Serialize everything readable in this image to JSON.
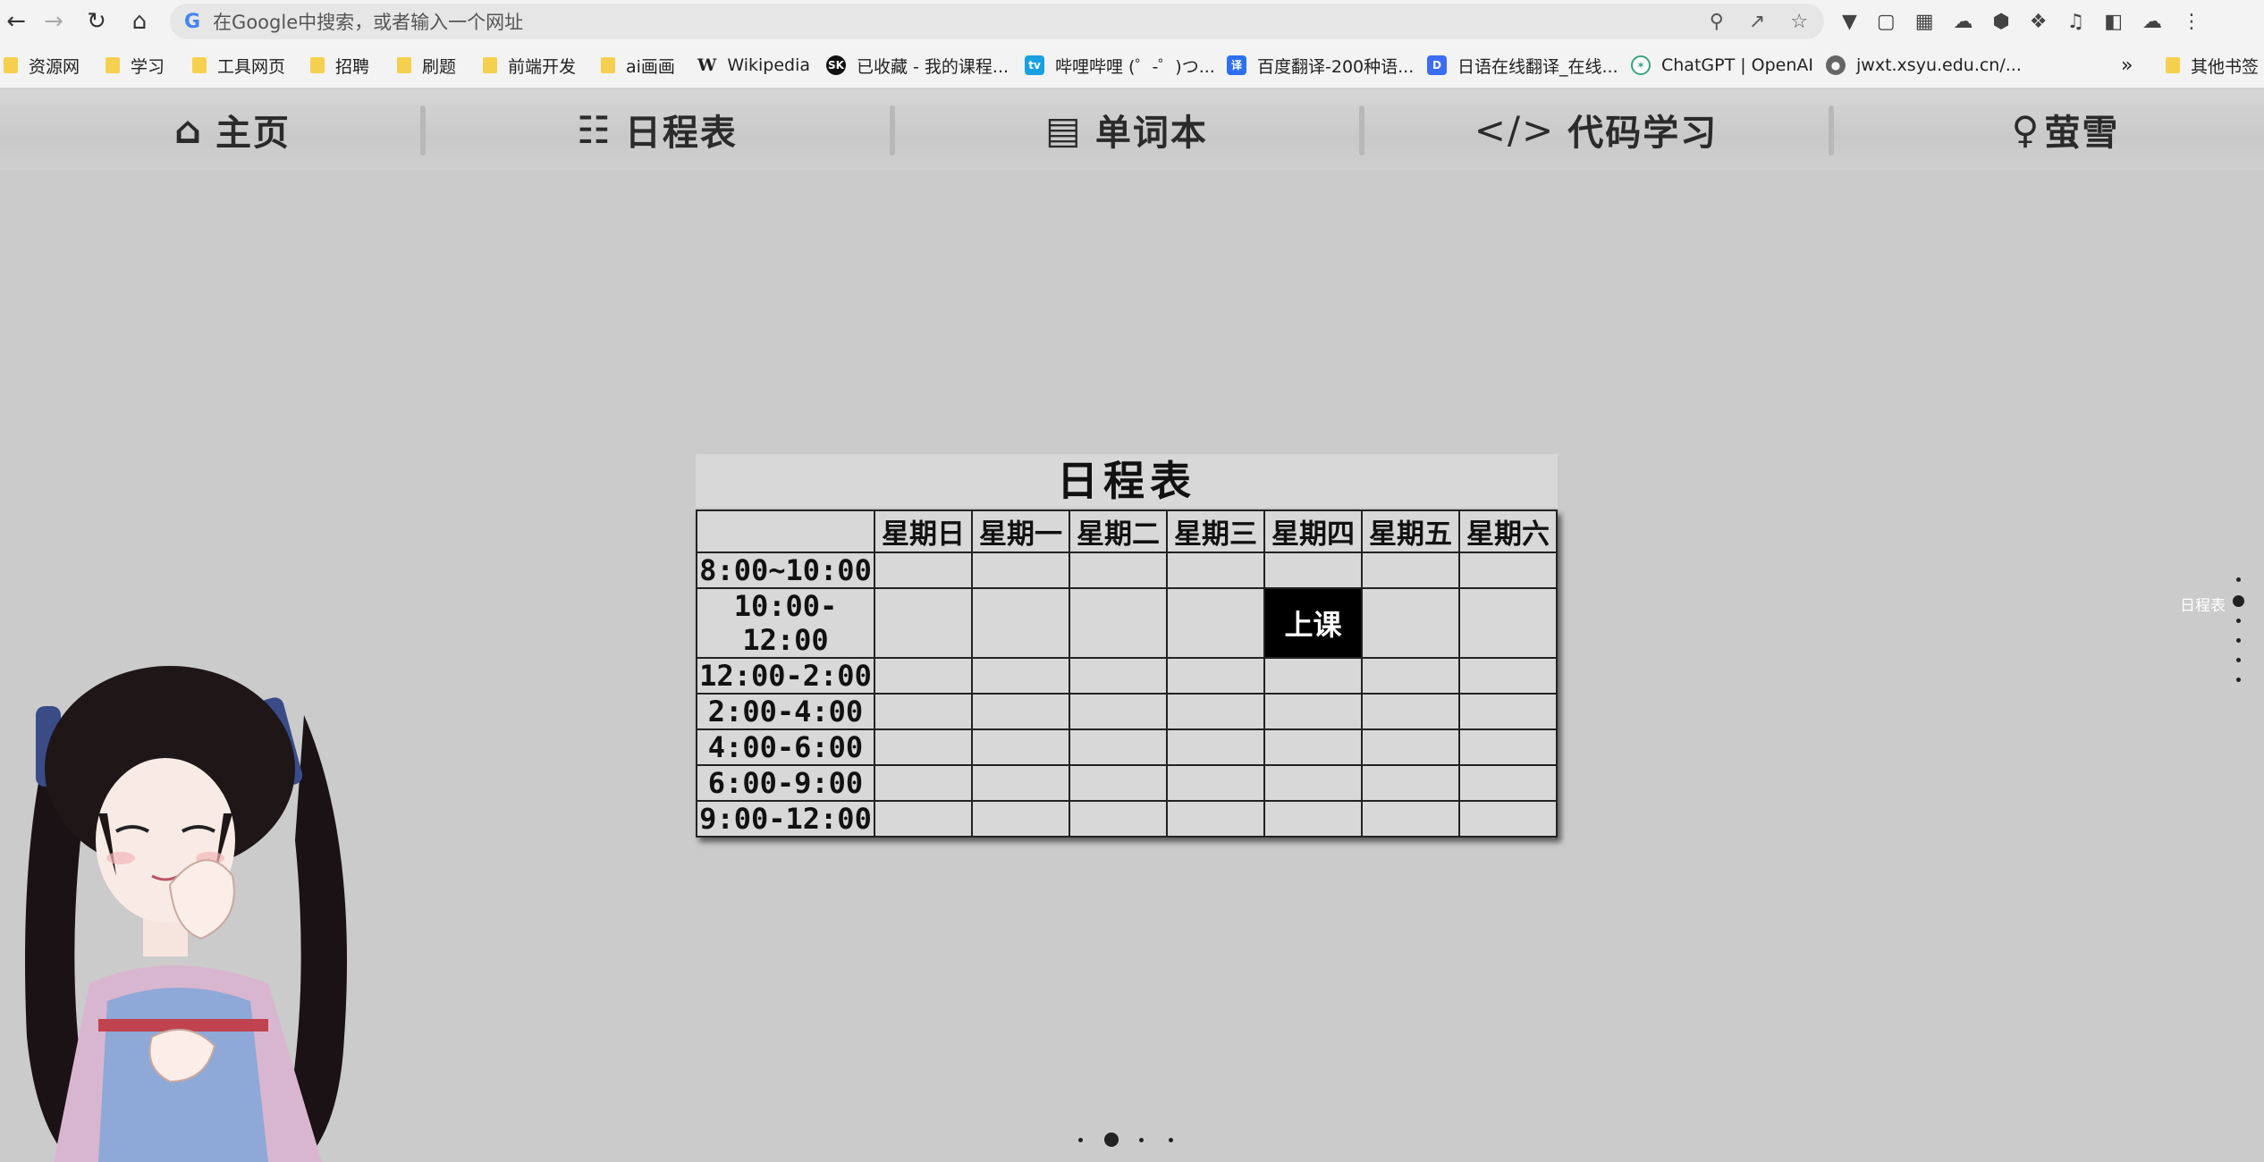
{
  "browser": {
    "omnibox_placeholder": "在Google中搜索，或者输入一个网址",
    "bookmarks": [
      {
        "label": "资源网",
        "type": "folder"
      },
      {
        "label": "学习",
        "type": "folder"
      },
      {
        "label": "工具网页",
        "type": "folder"
      },
      {
        "label": "招聘",
        "type": "folder"
      },
      {
        "label": "刷题",
        "type": "folder"
      },
      {
        "label": "前端开发",
        "type": "folder"
      },
      {
        "label": "ai画画",
        "type": "folder"
      },
      {
        "label": "Wikipedia",
        "type": "site"
      },
      {
        "label": "已收藏 - 我的课程...",
        "type": "site"
      },
      {
        "label": "哔哩哔哩 (゜-゜)つ...",
        "type": "site"
      },
      {
        "label": "百度翻译-200种语...",
        "type": "site"
      },
      {
        "label": "日语在线翻译_在线...",
        "type": "site"
      },
      {
        "label": "ChatGPT | OpenAI",
        "type": "site"
      },
      {
        "label": "jwxt.xsyu.edu.cn/...",
        "type": "site"
      }
    ],
    "more_label": "»",
    "other_bookmarks": "其他书签"
  },
  "site_nav": [
    {
      "label": "主页",
      "icon": "home-icon"
    },
    {
      "label": "日程表",
      "icon": "calendar-icon"
    },
    {
      "label": "单词本",
      "icon": "book-icon"
    },
    {
      "label": "代码学习",
      "icon": "code-icon"
    },
    {
      "label": "萤雪",
      "icon": "female-icon"
    }
  ],
  "schedule": {
    "title": "日程表",
    "days": [
      "星期日",
      "星期一",
      "星期二",
      "星期三",
      "星期四",
      "星期五",
      "星期六"
    ],
    "rows": [
      {
        "time": "8:00~10:00",
        "cells": [
          "",
          "",
          "",
          "",
          "",
          "",
          ""
        ]
      },
      {
        "time": "10:00-12:00",
        "cells": [
          "",
          "",
          "",
          "",
          "上课",
          "",
          ""
        ]
      },
      {
        "time": "12:00-2:00",
        "cells": [
          "",
          "",
          "",
          "",
          "",
          "",
          ""
        ]
      },
      {
        "time": "2:00-4:00",
        "cells": [
          "",
          "",
          "",
          "",
          "",
          "",
          ""
        ]
      },
      {
        "time": "4:00-6:00",
        "cells": [
          "",
          "",
          "",
          "",
          "",
          "",
          ""
        ]
      },
      {
        "time": "6:00-9:00",
        "cells": [
          "",
          "",
          "",
          "",
          "",
          "",
          ""
        ]
      },
      {
        "time": "9:00-12:00",
        "cells": [
          "",
          "",
          "",
          "",
          "",
          "",
          ""
        ]
      }
    ]
  },
  "side_nav": {
    "active_label": "日程表"
  },
  "colors": {
    "page_bg": "#cbcbcb",
    "busy_cell": "#000000",
    "table_bg": "#d8d8d8"
  }
}
